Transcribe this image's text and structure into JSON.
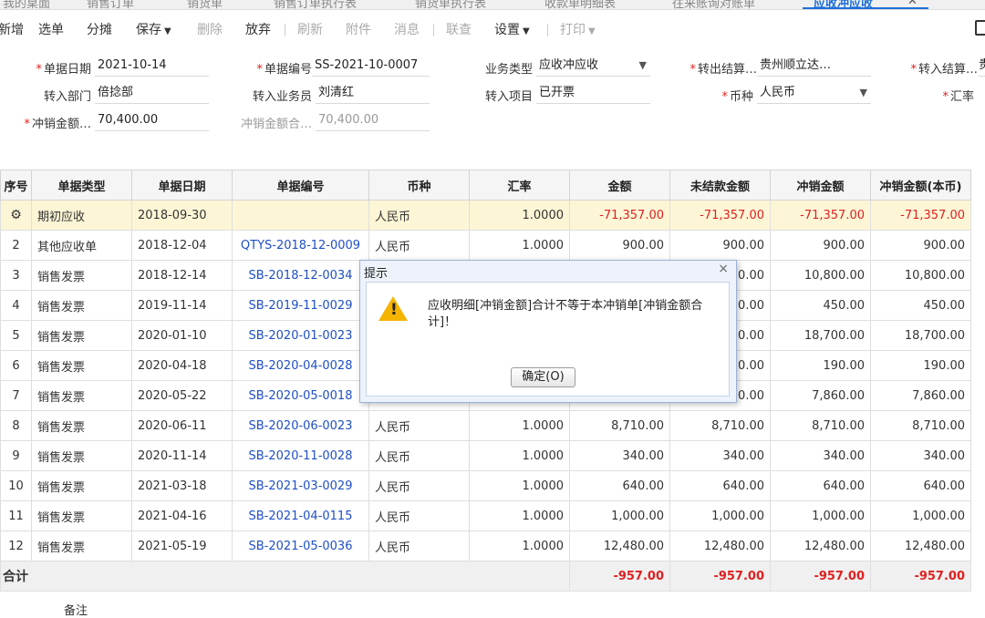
{
  "tabs": [
    {
      "label": "我的桌面"
    },
    {
      "label": "销售订单"
    },
    {
      "label": "销货单"
    },
    {
      "label": "销售订单执行表"
    },
    {
      "label": "销货单执行表"
    },
    {
      "label": "收款单明细表"
    },
    {
      "label": "往来账询对账单"
    },
    {
      "label": "应收冲应收"
    }
  ],
  "toolbar": {
    "new": "新增",
    "select": "选单",
    "allocate": "分摊",
    "save": "保存",
    "delete": "删除",
    "abandon": "放弃",
    "refresh": "刷新",
    "attach": "附件",
    "message": "消息",
    "linked": "联查",
    "settings": "设置",
    "print": "打印"
  },
  "form": {
    "doc_date_label": "单据日期",
    "doc_date": "2021-10-14",
    "doc_no_label": "单据编号",
    "doc_no": "SS-2021-10-0007",
    "biz_type_label": "业务类型",
    "biz_type": "应收冲应收",
    "out_unit_label": "转出结算…",
    "out_unit": "贵州顺立达…",
    "in_unit_label": "转入结算…",
    "in_unit": "贵",
    "in_dept_label": "转入部门",
    "in_dept": "倍捻部",
    "in_staff_label": "转入业务员",
    "in_staff": "刘清红",
    "in_project_label": "转入项目",
    "in_project": "已开票",
    "currency_label": "币种",
    "currency": "人民币",
    "rate_label": "汇率",
    "offset_amount_label": "冲销金额…",
    "offset_amount": "70,400.00",
    "offset_total_label": "冲销金额合…",
    "offset_total": "70,400.00"
  },
  "grid": {
    "headers": [
      "序号",
      "单据类型",
      "单据日期",
      "单据编号",
      "币种",
      "汇率",
      "金额",
      "未结款金额",
      "冲销金额",
      "冲销金额(本币)"
    ],
    "rows": [
      {
        "seq": "",
        "type": "期初应收",
        "date": "2018-09-30",
        "no": "",
        "cur": "人民币",
        "rate": "1.0000",
        "amt": "-71,357.00",
        "unpaid": "-71,357.00",
        "offset": "-71,357.00",
        "offset_local": "-71,357.00"
      },
      {
        "seq": "2",
        "type": "其他应收单",
        "date": "2018-12-04",
        "no": "QTYS-2018-12-0009",
        "cur": "人民币",
        "rate": "1.0000",
        "amt": "900.00",
        "unpaid": "900.00",
        "offset": "900.00",
        "offset_local": "900.00"
      },
      {
        "seq": "3",
        "type": "销售发票",
        "date": "2018-12-14",
        "no": "SB-2018-12-0034",
        "cur": "",
        "rate": "",
        "amt": "",
        "unpaid": "0.00",
        "offset": "10,800.00",
        "offset_local": "10,800.00"
      },
      {
        "seq": "4",
        "type": "销售发票",
        "date": "2019-11-14",
        "no": "SB-2019-11-0029",
        "cur": "",
        "rate": "",
        "amt": "",
        "unpaid": "0.00",
        "offset": "450.00",
        "offset_local": "450.00"
      },
      {
        "seq": "5",
        "type": "销售发票",
        "date": "2020-01-10",
        "no": "SB-2020-01-0023",
        "cur": "",
        "rate": "",
        "amt": "",
        "unpaid": "0.00",
        "offset": "18,700.00",
        "offset_local": "18,700.00"
      },
      {
        "seq": "6",
        "type": "销售发票",
        "date": "2020-04-18",
        "no": "SB-2020-04-0028",
        "cur": "",
        "rate": "",
        "amt": "",
        "unpaid": "0.00",
        "offset": "190.00",
        "offset_local": "190.00"
      },
      {
        "seq": "7",
        "type": "销售发票",
        "date": "2020-05-22",
        "no": "SB-2020-05-0018",
        "cur": "",
        "rate": "",
        "amt": "",
        "unpaid": "0.00",
        "offset": "7,860.00",
        "offset_local": "7,860.00"
      },
      {
        "seq": "8",
        "type": "销售发票",
        "date": "2020-06-11",
        "no": "SB-2020-06-0023",
        "cur": "人民币",
        "rate": "1.0000",
        "amt": "8,710.00",
        "unpaid": "8,710.00",
        "offset": "8,710.00",
        "offset_local": "8,710.00"
      },
      {
        "seq": "9",
        "type": "销售发票",
        "date": "2020-11-14",
        "no": "SB-2020-11-0028",
        "cur": "人民币",
        "rate": "1.0000",
        "amt": "340.00",
        "unpaid": "340.00",
        "offset": "340.00",
        "offset_local": "340.00"
      },
      {
        "seq": "10",
        "type": "销售发票",
        "date": "2021-03-18",
        "no": "SB-2021-03-0029",
        "cur": "人民币",
        "rate": "1.0000",
        "amt": "640.00",
        "unpaid": "640.00",
        "offset": "640.00",
        "offset_local": "640.00"
      },
      {
        "seq": "11",
        "type": "销售发票",
        "date": "2021-04-16",
        "no": "SB-2021-04-0115",
        "cur": "人民币",
        "rate": "1.0000",
        "amt": "1,000.00",
        "unpaid": "1,000.00",
        "offset": "1,000.00",
        "offset_local": "1,000.00"
      },
      {
        "seq": "12",
        "type": "销售发票",
        "date": "2021-05-19",
        "no": "SB-2021-05-0036",
        "cur": "人民币",
        "rate": "1.0000",
        "amt": "12,480.00",
        "unpaid": "12,480.00",
        "offset": "12,480.00",
        "offset_local": "12,480.00"
      }
    ],
    "total_label": "合计",
    "totals": {
      "amt": "-957.00",
      "unpaid": "-957.00",
      "offset": "-957.00",
      "offset_local": "-957.00"
    }
  },
  "remark_label": "备注",
  "dialog": {
    "title": "提示",
    "close": "×",
    "message": "应收明细[冲销金额]合计不等于本冲销单[冲销金额合计]！",
    "ok_label": "确定(O)"
  },
  "colors": {
    "accent": "#1e6fd9",
    "negative": "#e02020",
    "link": "#1f4fc7",
    "highlight_row": "#fdf6d6",
    "warning": "#f5b400"
  }
}
